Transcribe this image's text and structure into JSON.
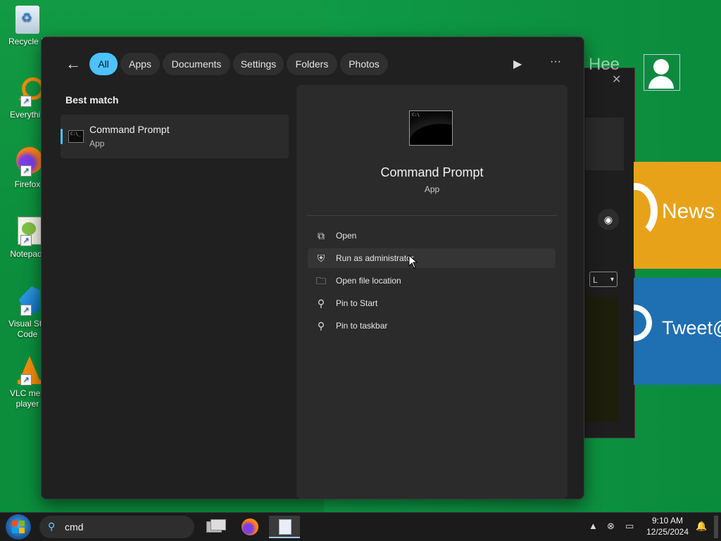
{
  "desktop": {
    "icons": [
      {
        "label": "Recycle B",
        "icon": "recycle-bin-icon"
      },
      {
        "label": "Everythin",
        "icon": "everything-search-icon"
      },
      {
        "label": "Firefox",
        "icon": "firefox-icon"
      },
      {
        "label": "Notepad-",
        "icon": "notepad-plus-plus-icon"
      },
      {
        "label": "Visual Stu\nCode",
        "icon": "vscode-icon"
      },
      {
        "label": "VLC med\nplayer",
        "icon": "vlc-icon"
      }
    ],
    "tiles": [
      {
        "label": "News",
        "color": "#e8a21a"
      },
      {
        "label": "Tweet@",
        "color": "#1f6fb3"
      }
    ],
    "background_window": {
      "combo_value": "L"
    }
  },
  "search_panel": {
    "filters": [
      {
        "label": "All",
        "active": true
      },
      {
        "label": "Apps"
      },
      {
        "label": "Documents"
      },
      {
        "label": "Settings"
      },
      {
        "label": "Folders"
      },
      {
        "label": "Photos"
      }
    ],
    "best_match_label": "Best match",
    "result": {
      "name": "Command Prompt",
      "type": "App"
    },
    "detail": {
      "title": "Command Prompt",
      "subtitle": "App",
      "actions": [
        {
          "label": "Open",
          "icon": "open-external-icon"
        },
        {
          "label": "Run as administrator",
          "icon": "shield-admin-icon"
        },
        {
          "label": "Open file location",
          "icon": "folder-icon"
        },
        {
          "label": "Pin to Start",
          "icon": "pin-icon"
        },
        {
          "label": "Pin to taskbar",
          "icon": "pin-icon"
        }
      ]
    }
  },
  "taskbar": {
    "search_value": "cmd",
    "time": "9:10 AM",
    "date": "12/25/2024"
  },
  "colors": {
    "accent": "#4cc2ff",
    "desktop_green": "#0b8d3c",
    "panel_bg": "#202020"
  }
}
